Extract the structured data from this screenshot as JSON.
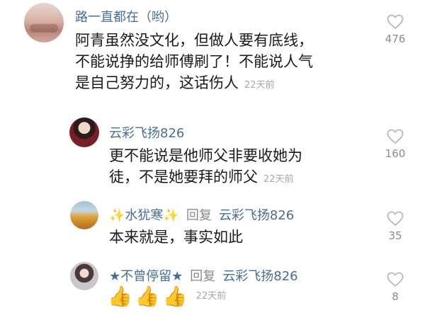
{
  "comments": [
    {
      "user": "路一直都在（哟）",
      "lines": [
        "阿青虽然没文化，但做人要有底线，",
        "不能说挣的给师傅刷了！不能说人气",
        "是自己努力的，这话伤人"
      ],
      "time": "22天前",
      "likes": "476"
    },
    {
      "user": "云彩飞扬826",
      "lines": [
        "更不能说是他师父非要收她为",
        "徒，不是她要拜的师父"
      ],
      "time": "22天前",
      "likes": "160"
    },
    {
      "user": "✨水犹寒✨",
      "reply_label": "回复",
      "reply_to": "云彩飞扬826",
      "lines": [
        "本来就是，事实如此"
      ],
      "likes": "35"
    },
    {
      "user": "★不曾停留★",
      "reply_label": "回复",
      "reply_to": "云彩飞扬826",
      "emoji": "👍👍👍",
      "time": "22天前",
      "likes": "8"
    }
  ],
  "icons": {
    "like": "heart-outline-icon"
  },
  "colors": {
    "username": "#4a6d93",
    "meta": "#a8a8a8",
    "reply": "#8a8a8a"
  }
}
